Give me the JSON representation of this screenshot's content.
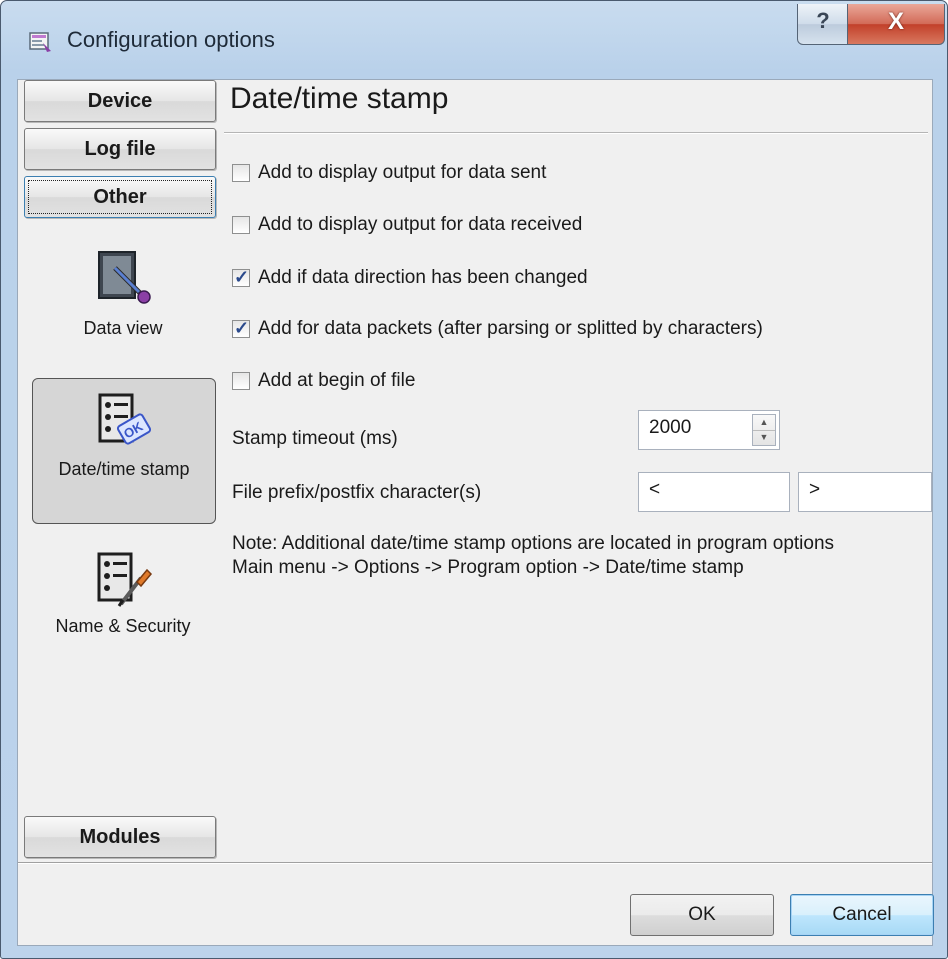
{
  "window": {
    "title": "Configuration options",
    "help_glyph": "?",
    "close_glyph": "X"
  },
  "sidebar": {
    "buttons": [
      {
        "label": "Device"
      },
      {
        "label": "Log file"
      },
      {
        "label": "Other",
        "active": true
      }
    ],
    "items": [
      {
        "label": "Data view",
        "icon": "data-view-icon"
      },
      {
        "label": "Date/time stamp",
        "icon": "date-time-stamp-icon",
        "selected": true
      },
      {
        "label": "Name & Security",
        "icon": "name-security-icon"
      }
    ],
    "modules_button": "Modules"
  },
  "panel": {
    "title": "Date/time stamp",
    "checkboxes": [
      {
        "label": "Add to display output for data sent",
        "checked": false
      },
      {
        "label": "Add to display output for data received",
        "checked": false
      },
      {
        "label": "Add if data direction has been changed",
        "checked": true
      },
      {
        "label": "Add for data packets (after parsing or splitted by characters)",
        "checked": true
      },
      {
        "label": "Add at begin of file",
        "checked": false
      }
    ],
    "stamp_timeout": {
      "label": "Stamp timeout (ms)",
      "value": "2000"
    },
    "prefix_postfix": {
      "label": "File prefix/postfix character(s)",
      "prefix": "<",
      "postfix": ">"
    },
    "note_line1": "Note: Additional date/time stamp options are located in program options",
    "note_line2": "Main menu -> Options -> Program option -> Date/time stamp"
  },
  "footer": {
    "ok_label": "OK",
    "cancel_label": "Cancel"
  },
  "colors": {
    "title_bar": "#b9d1ea",
    "close_button": "#c2402a",
    "default_button_border": "#3c7fb1",
    "checkmark": "#2b4a8c"
  }
}
